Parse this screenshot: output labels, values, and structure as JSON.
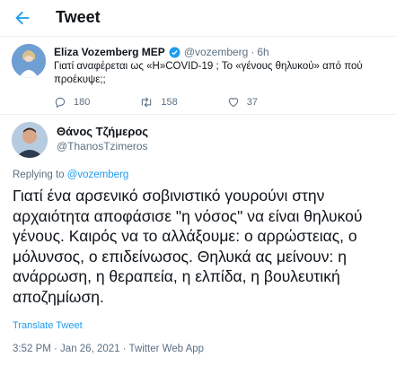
{
  "header": {
    "title": "Tweet"
  },
  "quoted_tweet": {
    "name": "Eliza Vozemberg MEP",
    "handle": "@vozemberg",
    "separator": "·",
    "time": "6h",
    "text": "Γιατί αναφέρεται ως  «Η»COVID-19 ; Το «γένους θηλυκού» από πού προέκυψε;;",
    "replies": "180",
    "retweets": "158",
    "likes": "37"
  },
  "author": {
    "name": "Θάνος Τζήμερος",
    "handle": "@ThanosTzimeros"
  },
  "replying": {
    "prefix": "Replying to ",
    "mention": "@vozemberg"
  },
  "tweet_text": "Γιατί ένα αρσενικό σοβινιστικό γουρούνι στην\nαρχαιότητα αποφάσισε \"η νόσος\" να είναι θηλυκού\nγένους. Καιρός να το αλλάξουμε: ο αρρώστειας, ο\nμόλυνσος, ο επιδείνωσος. Θηλυκά ας μείνουν: η\nανάρρωση, η θεραπεία, η ελπίδα, η βουλευτική\nαποζημίωση.",
  "translate_label": "Translate Tweet",
  "meta": "3:52 PM · Jan 26, 2021 · Twitter Web App",
  "colors": {
    "accent": "#1d9bf0",
    "muted": "#5b7083",
    "text": "#0f1419"
  }
}
